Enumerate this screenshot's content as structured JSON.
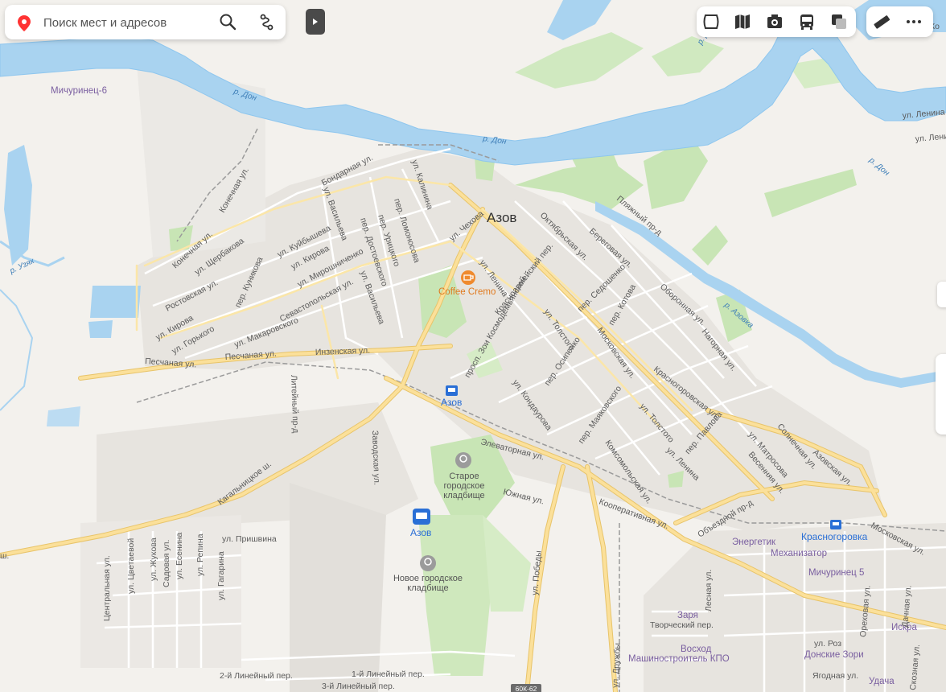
{
  "search": {
    "placeholder": "Поиск мест и адресов",
    "pin_icon": "location-pin-icon",
    "search_icon": "magnifier-icon",
    "route_icon": "route-icon"
  },
  "controls": {
    "expand_icon": "play-triangle-icon",
    "layers": [
      "panorama-icon",
      "map-guide-icon",
      "photos-icon",
      "transport-icon",
      "layers-switch-icon"
    ],
    "tools": [
      "ruler-icon",
      "more-icon"
    ]
  },
  "colors": {
    "water": "#a9d3f0",
    "river_edge": "#8ec6ee",
    "park": "#c8e5b5",
    "major_road": "#fbe09a",
    "major_road_edge": "#e8c46a",
    "land": "#f3f1ed",
    "urban": "#e6e3df"
  },
  "labels": {
    "city": "Азов",
    "rivers": [
      "р. Дон",
      "р. Дон",
      "р. Дон",
      "р. Дон",
      "р. Азовка",
      "р. Узяк"
    ],
    "districts": [
      "Мичуринец-6",
      "Энергетик",
      "Механизатор",
      "Мичуринец 5",
      "Заря",
      "Восход",
      "Машиностроитель КПО",
      "Искра",
      "Донские Зори",
      "Удача"
    ],
    "pois": {
      "coffee": "Coffee Cremo",
      "rail_station_1": "Азов",
      "bus_station": "Азов",
      "rail_station_2": "Красногоровка",
      "cemetery_old": [
        "Старое",
        "городское",
        "кладбище"
      ],
      "cemetery_new": [
        "Новое городское",
        "кладбище"
      ]
    },
    "streets": {
      "s01": "Бондарная ул.",
      "s02": "Конечная ул.",
      "s03": "Конечная ул.",
      "s04": "ул. Щербакова",
      "s05": "Ростовская ул.",
      "s06": "ул. Кирова",
      "s07": "ул. Горького",
      "s08": "ул. Куйбышева",
      "s09": "ул. Кирова",
      "s10": "пер. Куникова",
      "s11": "ул. Мирошниченко",
      "s12": "ул. Васильева",
      "s13": "пер. Достоевского",
      "s14": "пер. Урицкого",
      "s15": "пер. Ломоносова",
      "s16": "ул. Калинина",
      "s17": "ул. Чехова",
      "s18": "Севастопольская ул.",
      "s19": "ул. Макаровского",
      "s20": "ул. Васильева",
      "s21": "Песчаная ул.",
      "s22": "Песчаная ул.",
      "s23": "Инзенская ул.",
      "s24": "Литейный пр-д",
      "s25": "Кагальницкое ш.",
      "s26": "Заводская ул.",
      "s27": "ул. Ленина",
      "s28": "Красноармейский пер.",
      "s29": "просп. Зои Космодемьянской",
      "s30": "ул. Толстого",
      "s31": "пер. Осипенко",
      "s32": "ул. Кондаурова",
      "s33": "Октябрьская ул.",
      "s34": "Береговая ул.",
      "s35": "пер. Седошенко",
      "s36": "пер. Котова",
      "s37": "Московская ул.",
      "s38": "Оборонная ул.",
      "s39": "Нагорная ул.",
      "s40": "Пляжный пр-д",
      "s41": "Красногоровская ул.",
      "s42": "пер. Маяковского",
      "s43": "ул. Толстого",
      "s44": "Комсомольская ул.",
      "s45": "ул. Ленина",
      "s46": "пер. Павлова",
      "s47": "ул. Матросова",
      "s48": "Солнечная ул.",
      "s49": "Весенняя ул.",
      "s50": "Азовская ул.",
      "s51": "Объездной пр-д",
      "s52": "Кооперативная ул.",
      "s53": "Московская ул.",
      "s54": "Элеваторная ул.",
      "s55": "Южная ул.",
      "s56": "ул. Победы",
      "s57": "ул. Дружбы",
      "s58": "ул. Пришвина",
      "s59": "Центральная ул.",
      "s60": "ул. Цветаевой",
      "s61": "ул. Жукова",
      "s62": "Садовая ул.",
      "s63": "ул. Есенина",
      "s64": "ул. Репина",
      "s65": "ул. Гагарина",
      "s66": "2-й Линейный пер.",
      "s67": "1-й Линейный пер.",
      "s68": "3-й Линейный пер.",
      "s69": "Творческий пер.",
      "s70": "Лесная ул.",
      "s71": "Ореховая ул.",
      "s72": "Дачная ул.",
      "s73": "ул. Роз",
      "s74": "Ягодная ул.",
      "s75": "Скозная ул.",
      "s76": "ул. Ленина",
      "s77": "ул. Ленина",
      "s78": "Ко",
      "s79": "ш."
    },
    "road_shield": "60К-62"
  }
}
